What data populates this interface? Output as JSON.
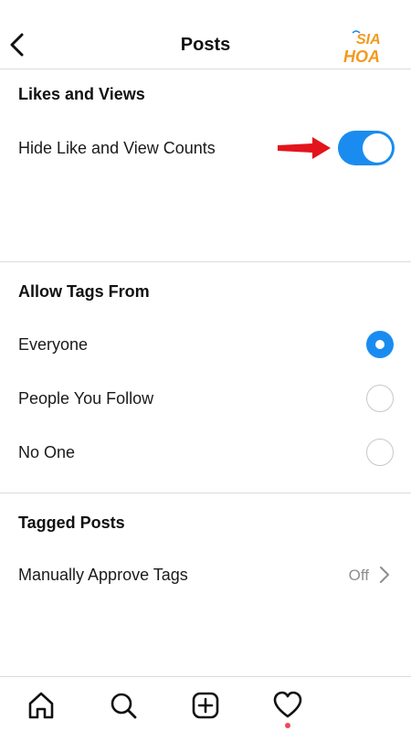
{
  "header": {
    "title": "Posts",
    "back_icon": "chevron-left-icon",
    "logo_text": "SIA HOA"
  },
  "likes_section": {
    "title": "Likes and Views",
    "hide_counts_label": "Hide Like and View Counts",
    "hide_counts_enabled": true,
    "toggle_color": "#1a8cf0",
    "annotation": "red-arrow-icon"
  },
  "tags_section": {
    "title": "Allow Tags From",
    "options": [
      {
        "label": "Everyone",
        "selected": true
      },
      {
        "label": "People You Follow",
        "selected": false
      },
      {
        "label": "No One",
        "selected": false
      }
    ]
  },
  "tagged_section": {
    "title": "Tagged Posts",
    "approve_label": "Manually Approve Tags",
    "approve_value": "Off"
  },
  "tabbar": {
    "icons": [
      "home-icon",
      "search-icon",
      "add-post-icon",
      "activity-heart-icon"
    ],
    "notification_dot_color": "#ed4956"
  }
}
